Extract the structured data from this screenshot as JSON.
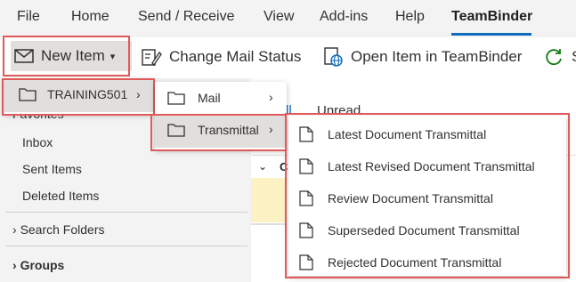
{
  "menubar": {
    "items": [
      "File",
      "Home",
      "Send / Receive",
      "View",
      "Add-ins",
      "Help",
      "TeamBinder"
    ],
    "active": "TeamBinder"
  },
  "ribbon": {
    "new_item": "New Item",
    "change_mail_status": "Change Mail Status",
    "open_item": "Open Item in TeamBinder",
    "partial_s": "S"
  },
  "list": {
    "unread_tab": "Unread",
    "all_tab_partial": "ll",
    "sort_partial": "C"
  },
  "nav": {
    "favorites": "Favorites",
    "items": [
      "Inbox",
      "Sent Items",
      "Deleted Items"
    ],
    "search_folders": "Search Folders",
    "groups": "Groups"
  },
  "menu1": {
    "items": [
      "TRAINING501"
    ]
  },
  "menu2": {
    "items": [
      "Mail",
      "Transmittal"
    ]
  },
  "menu3": {
    "items": [
      "Latest Document Transmittal",
      "Latest Revised Document Transmittal",
      "Review Document Transmittal",
      "Superseded Document Transmittal",
      "Rejected Document Transmittal"
    ]
  },
  "colors": {
    "highlight": "#e05a5a",
    "accent": "#0f6cbd",
    "unread_row": "#fcf2c4"
  },
  "icons": [
    "envelope-icon",
    "dropdown-caret-icon",
    "edit-status-icon",
    "globe-open-icon",
    "refresh-icon",
    "folder-icon",
    "document-icon",
    "chevron-right-icon",
    "chevron-down-icon"
  ]
}
